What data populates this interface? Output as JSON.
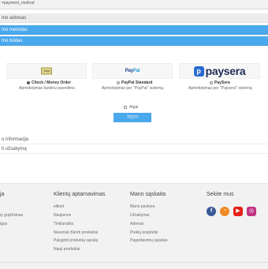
{
  "browser": {
    "url": "=payment_method"
  },
  "sections": {
    "address": "mo adresas",
    "shipping": "mo metodas",
    "payment": "mo būdas",
    "info": "o informacija",
    "confirm": "ti užsakymą"
  },
  "payment_methods": [
    {
      "name": "Check / Money Order",
      "description": "Apmokėjimas banknu pavedimu",
      "selected": true
    },
    {
      "name": "PayPal Standard",
      "description": "Apmokėjimas per \"PayPal\" sistemą",
      "selected": false
    },
    {
      "name": "PaySera",
      "description": "Apmokėjimas per \"Paysera\" sistemą",
      "selected": false
    }
  ],
  "logos": {
    "paypal_a": "Pay",
    "paypal_b": "Pal",
    "paysera_icon": "p",
    "paysera_text": "paysera"
  },
  "agree_label": "Atgal",
  "next_button": "TĘSTI",
  "footer": {
    "col1": {
      "title": "ja",
      "links": [
        "iy grąžinimas",
        "igos"
      ]
    },
    "col2": {
      "title": "Klientų aptarnavimas",
      "links": [
        "eitkeit",
        "Naujienos",
        "Tinklaraštis",
        "Neseniai žiūrėti produktai",
        "Palyginti produktų sąrašą",
        "Nauji produktai"
      ]
    },
    "col3": {
      "title": "Mano sąskaita",
      "links": [
        "Mano paskyra",
        "Užsakymai",
        "Adresai",
        "Prekių krepšelis",
        "Pageidavimų sąrašas"
      ]
    },
    "col4": {
      "title": "Sekite mus"
    }
  },
  "social_icons": [
    "facebook-icon",
    "rss-icon",
    "youtube-icon",
    "instagram-icon"
  ],
  "colors": {
    "accent": "#4aa8ec",
    "footer_bg": "#f2f2f2"
  }
}
